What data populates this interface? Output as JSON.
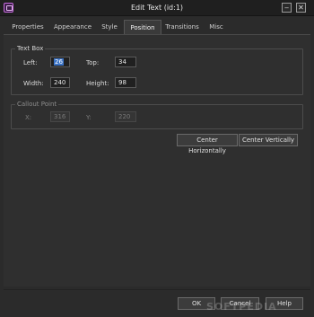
{
  "window": {
    "title": "Edit Text (id:1)",
    "minimize_glyph": "‒",
    "close_glyph": "✕"
  },
  "tabs": [
    {
      "label": "Properties"
    },
    {
      "label": "Appearance"
    },
    {
      "label": "Style"
    },
    {
      "label": "Position",
      "active": true
    },
    {
      "label": "Transitions"
    },
    {
      "label": "Misc"
    }
  ],
  "text_box": {
    "legend": "Text Box",
    "left_label": "Left:",
    "left_value": "26",
    "top_label": "Top:",
    "top_value": "34",
    "width_label": "Width:",
    "width_value": "240",
    "height_label": "Height:",
    "height_value": "98"
  },
  "callout_point": {
    "legend": "Callout Point",
    "x_label": "X:",
    "x_value": "316",
    "y_label": "Y:",
    "y_value": "220"
  },
  "buttons": {
    "center_horizontally": "Center Horizontally",
    "center_vertically": "Center Vertically",
    "ok": "OK",
    "cancel": "Cancel",
    "help": "Help"
  },
  "watermark": "SOFTPEDIA",
  "colors": {
    "background": "#2b2b2b",
    "selection": "#3b73c6",
    "app_icon_accent": "#c86de0"
  }
}
